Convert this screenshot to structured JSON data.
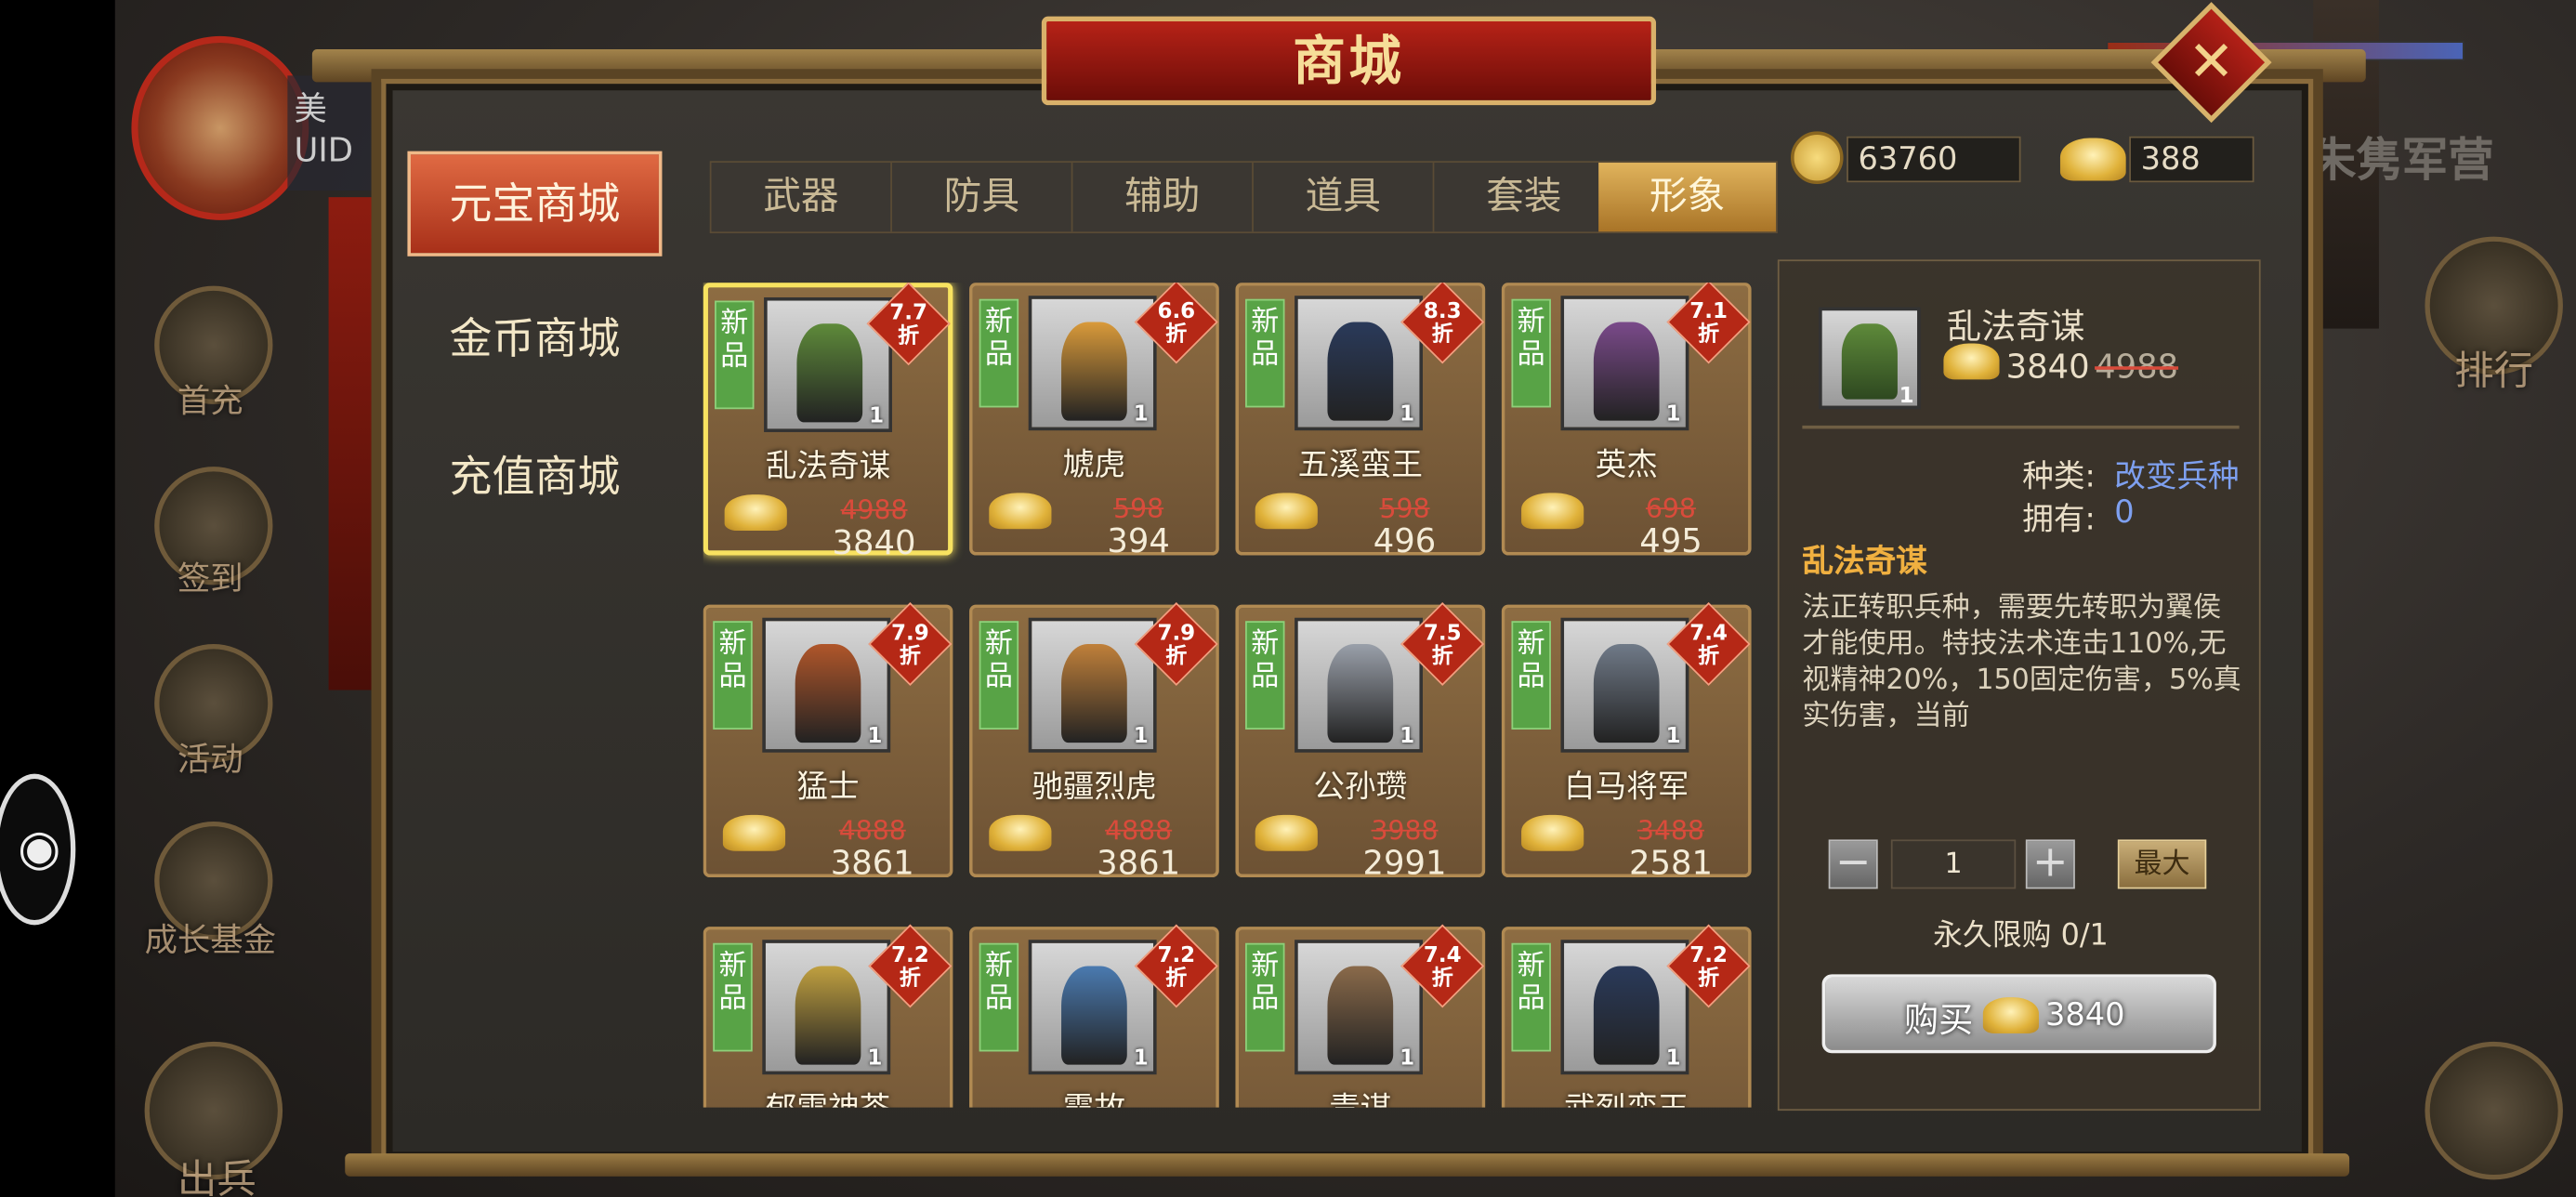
{
  "title": "商城",
  "currency": {
    "coins": "63760",
    "ingots": "388"
  },
  "background_labels": {
    "uid_name": "美",
    "uid": "UID",
    "left_menu": [
      "首充",
      "签到",
      "活动",
      "成长基金",
      "出兵"
    ],
    "right_title": "朱隽军营",
    "ranking": "排行"
  },
  "sidebar": [
    "元宝商城",
    "金币商城",
    "充值商城"
  ],
  "tabs": [
    "武器",
    "防具",
    "辅助",
    "道具",
    "套装",
    "形象"
  ],
  "new_tag": "新品",
  "discount_suffix": "折",
  "items": [
    {
      "name": "乱法奇谋",
      "discount": "7.7",
      "old": "4988",
      "price": "3840",
      "qty": "1"
    },
    {
      "name": "虓虎",
      "discount": "6.6",
      "old": "598",
      "price": "394",
      "qty": "1"
    },
    {
      "name": "五溪蛮王",
      "discount": "8.3",
      "old": "598",
      "price": "496",
      "qty": "1"
    },
    {
      "name": "英杰",
      "discount": "7.1",
      "old": "698",
      "price": "495",
      "qty": "1"
    },
    {
      "name": "猛士",
      "discount": "7.9",
      "old": "4888",
      "price": "3861",
      "qty": "1"
    },
    {
      "name": "驰疆烈虎",
      "discount": "7.9",
      "old": "4888",
      "price": "3861",
      "qty": "1"
    },
    {
      "name": "公孙瓒",
      "discount": "7.5",
      "old": "3988",
      "price": "2991",
      "qty": "1"
    },
    {
      "name": "白马将军",
      "discount": "7.4",
      "old": "3488",
      "price": "2581",
      "qty": "1"
    },
    {
      "name": "郁雪神茶",
      "discount": "7.2",
      "old": "",
      "price": "",
      "qty": "1"
    },
    {
      "name": "霞故",
      "discount": "7.2",
      "old": "",
      "price": "",
      "qty": "1"
    },
    {
      "name": "青谋",
      "discount": "7.4",
      "old": "",
      "price": "",
      "qty": "1"
    },
    {
      "name": "武烈蛮王",
      "discount": "7.2",
      "old": "",
      "price": "",
      "qty": "1"
    }
  ],
  "detail": {
    "name": "乱法奇谋",
    "price": "3840",
    "old_price": "4988",
    "qty_badge": "1",
    "type_label": "种类:",
    "type_value": "改变兵种",
    "own_label": "拥有:",
    "own_value": "0",
    "heading": "乱法奇谋",
    "description": "法正转职兵种，需要先转职为翼侯才能使用。特技法术连击110%,无视精神20%，150固定伤害，5%真实伤害，当前",
    "quantity": "1",
    "max_label": "最大",
    "limit": "永久限购  0/1",
    "buy_label": "购买",
    "buy_price": "3840"
  },
  "colors": {
    "accent_red": "#b62217",
    "gold": "#e0b35c",
    "green_tag": "#58a346",
    "discount_red": "#b52816"
  }
}
